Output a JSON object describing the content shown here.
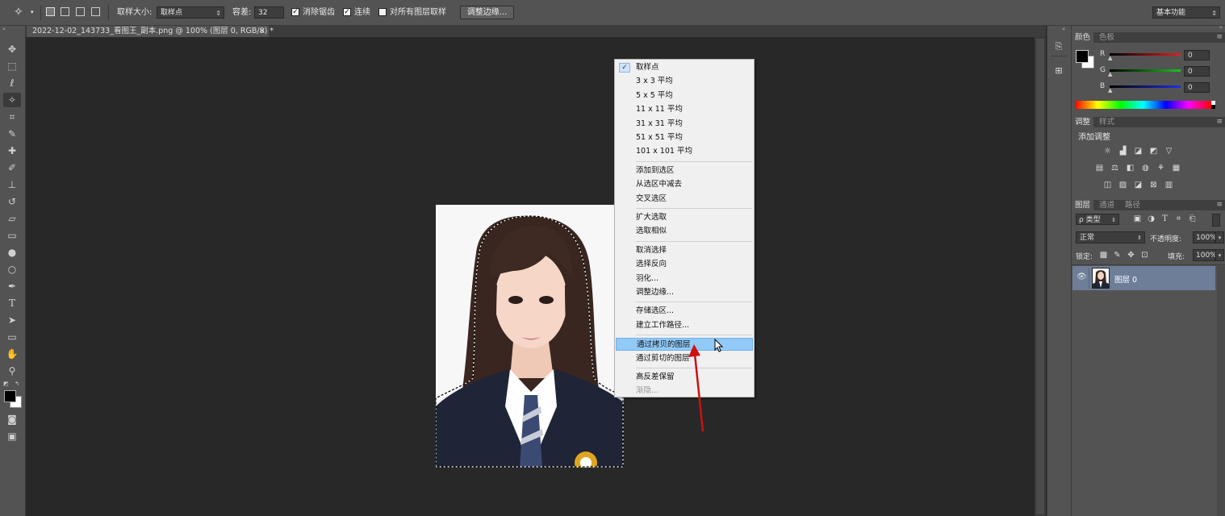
{
  "options_bar": {
    "sample_size_label": "取样大小:",
    "sample_size_value": "取样点",
    "tolerance_label": "容差:",
    "tolerance_value": "32",
    "antialias_label": "消除锯齿",
    "antialias_checked": true,
    "contiguous_label": "连续",
    "contiguous_checked": true,
    "all_layers_label": "对所有图层取样",
    "all_layers_checked": false,
    "refine_edge_button": "调整边缘...",
    "workspace_value": "基本功能"
  },
  "document": {
    "tab_title": "2022-12-02_143733_看图王_副本.png @ 100% (图层 0, RGB/8) *",
    "close_glyph": "×"
  },
  "context_menu": {
    "groups": [
      [
        {
          "label": "取样点",
          "checked": true
        },
        {
          "label": "3 x 3 平均"
        },
        {
          "label": "5 x 5 平均"
        },
        {
          "label": "11 x 11 平均"
        },
        {
          "label": "31 x 31 平均"
        },
        {
          "label": "51 x 51 平均"
        },
        {
          "label": "101 x 101 平均"
        }
      ],
      [
        {
          "label": "添加到选区"
        },
        {
          "label": "从选区中减去"
        },
        {
          "label": "交叉选区"
        }
      ],
      [
        {
          "label": "扩大选取"
        },
        {
          "label": "选取相似"
        }
      ],
      [
        {
          "label": "取消选择"
        },
        {
          "label": "选择反向"
        },
        {
          "label": "羽化..."
        },
        {
          "label": "调整边缘..."
        }
      ],
      [
        {
          "label": "存储选区..."
        },
        {
          "label": "建立工作路径..."
        }
      ],
      [
        {
          "label": "通过拷贝的图层",
          "highlighted": true
        },
        {
          "label": "通过剪切的图层"
        }
      ],
      [
        {
          "label": "高反差保留"
        },
        {
          "label": "渐隐...",
          "disabled": true
        }
      ]
    ]
  },
  "color_panel": {
    "tabs": [
      "颜色",
      "色板"
    ],
    "channels": [
      {
        "label": "R",
        "value": "0",
        "color": "#e02020"
      },
      {
        "label": "G",
        "value": "0",
        "color": "#20c020"
      },
      {
        "label": "B",
        "value": "0",
        "color": "#2030e0"
      }
    ]
  },
  "adjustments_panel": {
    "tabs": [
      "调整",
      "样式"
    ],
    "heading": "添加调整"
  },
  "layers_panel": {
    "tabs": [
      "图层",
      "通道",
      "路径"
    ],
    "filter_kind": "ρ 类型",
    "blend_mode": "正常",
    "opacity_label": "不透明度:",
    "opacity_value": "100%",
    "lock_label": "锁定:",
    "fill_label": "填充:",
    "fill_value": "100%",
    "layers": [
      {
        "name": "图层 0",
        "visible": true,
        "selected": true
      }
    ]
  },
  "colors": {
    "ui_dark": "#535353",
    "canvas_bg": "#282828",
    "menu_highlight": "#91c9f7",
    "arrow_red": "#cc1111"
  }
}
